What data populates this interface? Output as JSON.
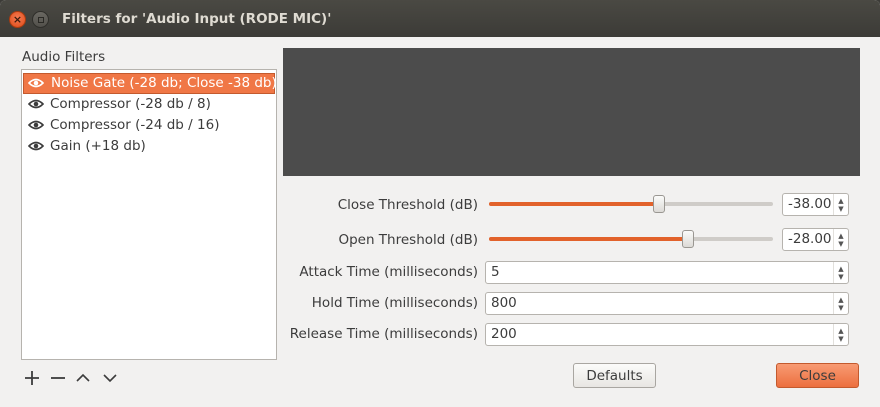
{
  "window": {
    "title": "Filters for 'Audio Input (RODE MIC)'"
  },
  "filters": {
    "heading": "Audio Filters",
    "items": [
      {
        "label": "Noise Gate (-28 db; Close -38 db)",
        "visible_icon": "eye-icon",
        "selected": true
      },
      {
        "label": "Compressor (-28 db / 8)",
        "visible_icon": "eye-icon",
        "selected": false
      },
      {
        "label": "Compressor (-24 db / 16)",
        "visible_icon": "eye-icon",
        "selected": false
      },
      {
        "label": "Gain (+18 db)",
        "visible_icon": "eye-icon",
        "selected": false
      }
    ],
    "tools": [
      {
        "symbol": "+",
        "icon": "add-icon"
      },
      {
        "symbol": "−",
        "icon": "remove-icon"
      },
      {
        "symbol": "⌃",
        "icon": "move-up-icon"
      },
      {
        "symbol": "⌄",
        "icon": "move-down-icon"
      }
    ]
  },
  "properties": {
    "close_threshold": {
      "label": "Close Threshold (dB)",
      "value": "-38.00",
      "slider_fraction": 0.6
    },
    "open_threshold": {
      "label": "Open Threshold (dB)",
      "value": "-28.00",
      "slider_fraction": 0.7
    },
    "attack_time": {
      "label": "Attack Time (milliseconds)",
      "value": "5"
    },
    "hold_time": {
      "label": "Hold Time (milliseconds)",
      "value": "800"
    },
    "release_time": {
      "label": "Release Time (milliseconds)",
      "value": "200"
    }
  },
  "buttons": {
    "defaults": "Defaults",
    "close_mnemonic": "C",
    "close_rest": "lose"
  },
  "colors": {
    "accent": "#f07746",
    "slider_fill": "#e2622b",
    "preview_bg": "#4c4c4c",
    "titlebar": "#3c3b37"
  }
}
